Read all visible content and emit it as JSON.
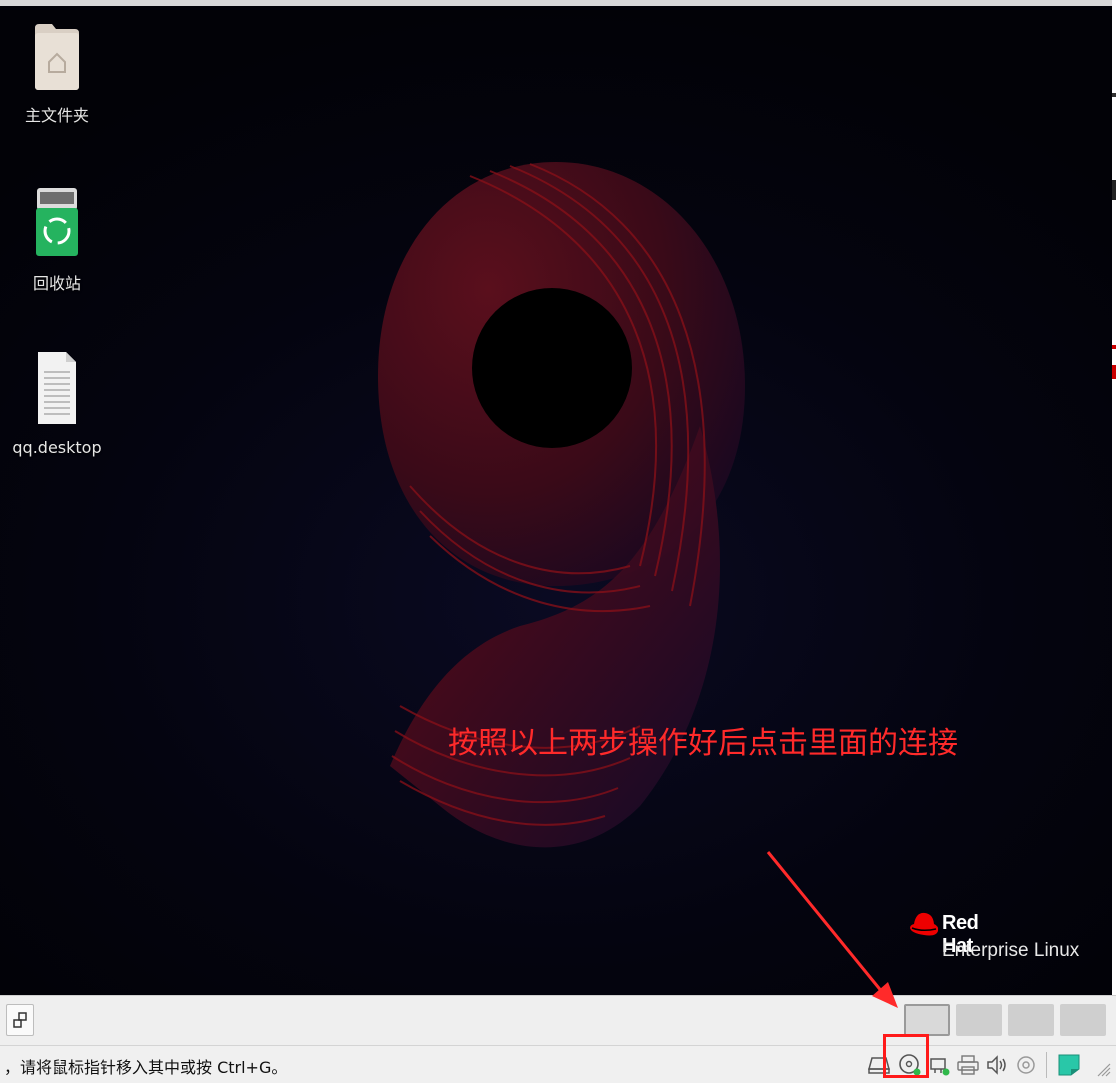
{
  "desktop": {
    "icons": [
      {
        "label": "主文件夹",
        "icon": "home-folder-icon"
      },
      {
        "label": "回收站",
        "icon": "recycle-bin-icon"
      },
      {
        "label": "qq.desktop",
        "icon": "text-file-icon"
      }
    ],
    "annotation": "按照以上两步操作好后点击里面的连接",
    "brand": {
      "name": "Red Hat",
      "product": "Enterprise Linux"
    }
  },
  "taskbar": {
    "left_button_icon": "window-switch-icon",
    "workspaces": 4,
    "active_workspace": 1
  },
  "statusbar": {
    "text": "，请将鼠标指针移入其中或按 Ctrl+G。",
    "icons": [
      "hard-disk-icon",
      "cd-dvd-icon",
      "network-adapter-icon",
      "printer-icon",
      "sound-icon",
      "usb-device-icon",
      "message-icon"
    ]
  },
  "colors": {
    "annotation": "#ff2a2a",
    "brand_red": "#ee0000",
    "highlight": "#ff1a1a"
  }
}
